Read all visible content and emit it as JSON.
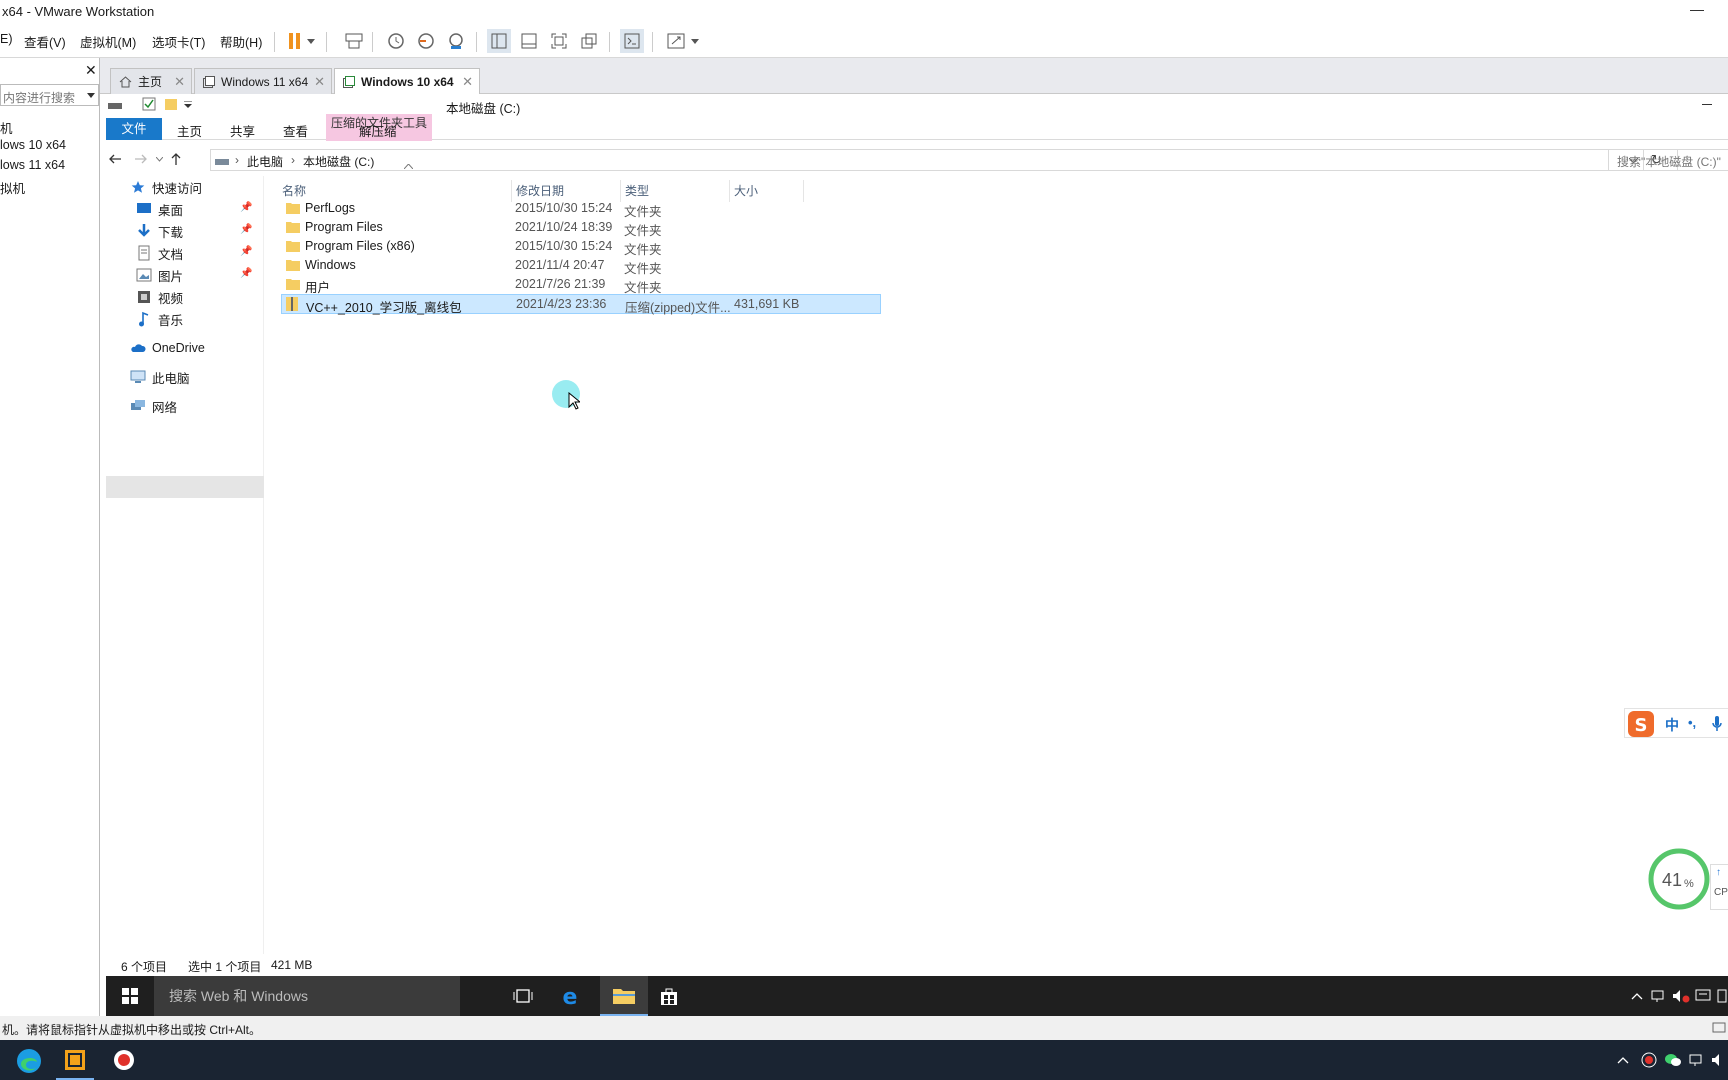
{
  "vm": {
    "title": "x64 - VMware Workstation",
    "menu": [
      "E)",
      "查看(V)",
      "虚拟机(M)",
      "选项卡(T)",
      "帮助(H)"
    ],
    "library": {
      "search_placeholder": "内容进行搜索",
      "items": [
        "机",
        "lows 10 x64",
        "lows 11 x64",
        "拟机"
      ]
    },
    "tabs": [
      {
        "label": "主页"
      },
      {
        "label": "Windows 11 x64"
      },
      {
        "label": "Windows 10 x64"
      }
    ],
    "status_text": "机。请将鼠标指针从虚拟机中移出或按 Ctrl+Alt。"
  },
  "explorer": {
    "window_title": "本地磁盘 (C:)",
    "context_tools": "压缩的文件夹工具",
    "ribbon": {
      "file": "文件",
      "home": "主页",
      "share": "共享",
      "view": "查看",
      "extract": "解压缩"
    },
    "breadcrumb": [
      "此电脑",
      "本地磁盘 (C:)"
    ],
    "search_placeholder": "搜索\"本地磁盘 (C:)\"",
    "nav": {
      "quick_access": "快速访问",
      "desktop": "桌面",
      "downloads": "下载",
      "documents": "文档",
      "pictures": "图片",
      "videos": "视频",
      "music": "音乐",
      "onedrive": "OneDrive",
      "this_pc": "此电脑",
      "network": "网络"
    },
    "columns": {
      "name": "名称",
      "date": "修改日期",
      "type": "类型",
      "size": "大小"
    },
    "files": [
      {
        "name": "PerfLogs",
        "date": "2015/10/30 15:24",
        "type": "文件夹",
        "size": ""
      },
      {
        "name": "Program Files",
        "date": "2021/10/24 18:39",
        "type": "文件夹",
        "size": ""
      },
      {
        "name": "Program Files (x86)",
        "date": "2015/10/30 15:24",
        "type": "文件夹",
        "size": ""
      },
      {
        "name": "Windows",
        "date": "2021/11/4 20:47",
        "type": "文件夹",
        "size": ""
      },
      {
        "name": "用户",
        "date": "2021/7/26 21:39",
        "type": "文件夹",
        "size": ""
      },
      {
        "name": "VC++_2010_学习版_离线包",
        "date": "2021/4/23 23:36",
        "type": "压缩(zipped)文件...",
        "size": "431,691 KB"
      }
    ],
    "status": {
      "count": "6 个项目",
      "selected": "选中 1 个项目",
      "size": "421 MB"
    }
  },
  "guest_taskbar": {
    "search_placeholder": "搜索 Web 和 Windows"
  },
  "ime": {
    "mode": "中",
    "punct": "•,"
  },
  "perf": {
    "value": "41",
    "unit": "%",
    "label": "CP"
  },
  "colors": {
    "accent": "#1979ca",
    "selection": "#cce8ff",
    "context_tab": "#f6c7e1",
    "folder": "#f5cd62"
  }
}
